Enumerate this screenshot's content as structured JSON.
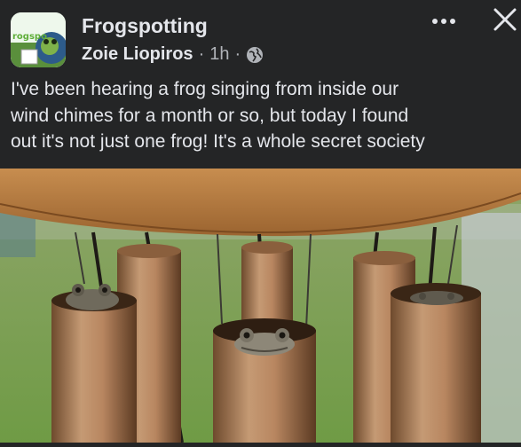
{
  "post": {
    "group_name": "Frogspotting",
    "author": "Zoie Liopiros",
    "time": "1h",
    "separator": "·",
    "text_line1": "I've been hearing a frog singing from inside our",
    "text_line2": "wind chimes for a month or so, but today I found",
    "text_line3": "out it's not just one frog! It's a whole secret society"
  },
  "avatar": {
    "logo_text": "rogspo"
  },
  "icons": {
    "more": "more-horizontal-icon",
    "close": "close-icon",
    "audience": "globe-icon"
  },
  "colors": {
    "background": "#242526",
    "primary_text": "#e4e6eb",
    "secondary_text": "#b0b3b8"
  }
}
